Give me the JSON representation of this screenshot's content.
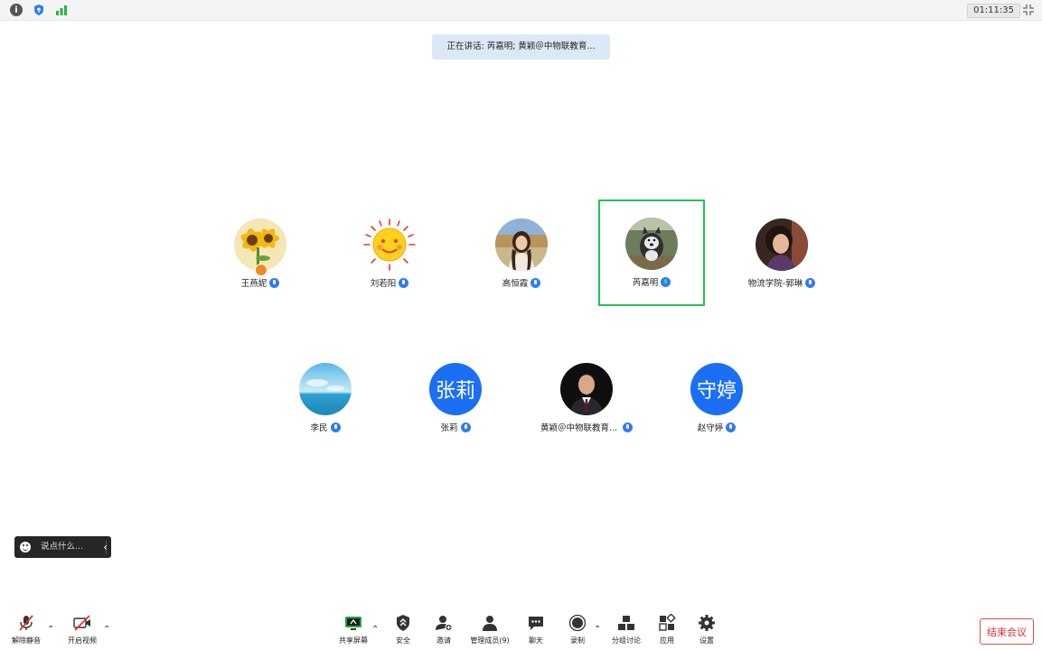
{
  "timer": "01:11:35",
  "speaking_banner": "正在讲话: 芮嘉明; 黄颖＠中物联教育...",
  "participants_row1": [
    {
      "name": "王燕妮",
      "avatar": "sunflower"
    },
    {
      "name": "刘若阳",
      "avatar": "sun-smile"
    },
    {
      "name": "高恒霞",
      "avatar": "photo-woman"
    },
    {
      "name": "芮嘉明",
      "avatar": "photo-dog"
    },
    {
      "name": "物流学院-郭琳",
      "avatar": "photo-woman-2"
    }
  ],
  "participants_row2": [
    {
      "name": "李民",
      "avatar": "sky"
    },
    {
      "name": "张莉",
      "avatar_text": "张莉"
    },
    {
      "name": "黄颖＠中物联教育...",
      "avatar": "photo-man"
    },
    {
      "name": "赵守婷",
      "avatar_text": "守婷"
    }
  ],
  "chat_placeholder": "说点什么...",
  "toolbar": {
    "unmute": "解除静音",
    "start_video": "开启视频",
    "share_screen": "共享屏幕",
    "security": "安全",
    "invite": "邀请",
    "manage_members": "管理成员(9)",
    "chat": "聊天",
    "record": "录制",
    "breakout": "分组讨论",
    "apps": "应用",
    "settings": "设置",
    "end_meeting": "结束会议"
  },
  "colors": {
    "accent_blue": "#1b6ff5",
    "active_border": "#23c451",
    "end_red": "#e02f2f",
    "banner_bg": "#dbe8f8"
  }
}
